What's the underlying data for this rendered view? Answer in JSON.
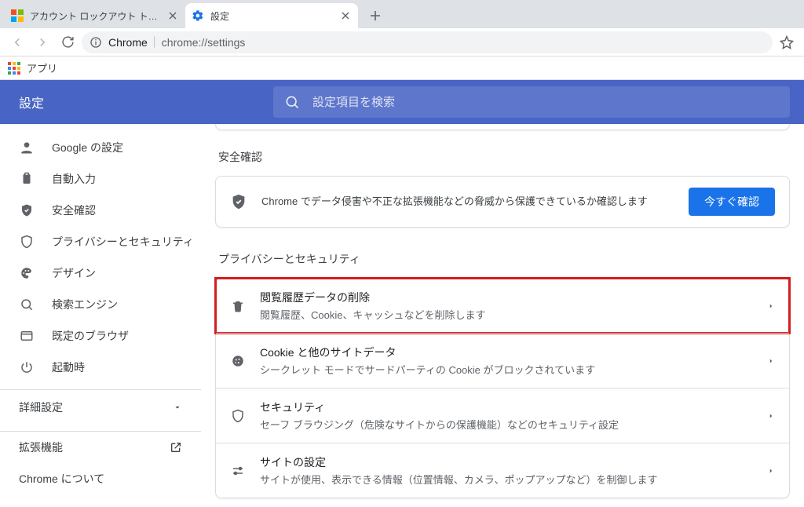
{
  "browser": {
    "tabs": [
      {
        "title": "アカウント ロックアウト トラブルシューティング",
        "active": false
      },
      {
        "title": "設定",
        "active": true
      }
    ],
    "omnibox": {
      "origin": "Chrome",
      "path": "chrome://settings"
    },
    "bookmarks_bar": {
      "apps_label": "アプリ"
    }
  },
  "settings": {
    "app_title": "設定",
    "search_placeholder": "設定項目を検索",
    "sidebar": {
      "items": [
        {
          "label": "Google の設定"
        },
        {
          "label": "自動入力"
        },
        {
          "label": "安全確認"
        },
        {
          "label": "プライバシーとセキュリティ"
        },
        {
          "label": "デザイン"
        },
        {
          "label": "検索エンジン"
        },
        {
          "label": "既定のブラウザ"
        },
        {
          "label": "起動時"
        }
      ],
      "advanced_label": "詳細設定",
      "footer": {
        "extensions_label": "拡張機能",
        "about_label": "Chrome について"
      }
    },
    "sections": {
      "safety": {
        "title": "安全確認",
        "card_text": "Chrome でデータ侵害や不正な拡張機能などの脅威から保護できているか確認します",
        "button_label": "今すぐ確認"
      },
      "privacy": {
        "title": "プライバシーとセキュリティ",
        "rows": [
          {
            "title": "閲覧履歴データの削除",
            "desc": "閲覧履歴、Cookie、キャッシュなどを削除します",
            "highlight": true
          },
          {
            "title": "Cookie と他のサイトデータ",
            "desc": "シークレット モードでサードパーティの Cookie がブロックされています",
            "highlight": false
          },
          {
            "title": "セキュリティ",
            "desc": "セーフ ブラウジング（危険なサイトからの保護機能）などのセキュリティ設定",
            "highlight": false
          },
          {
            "title": "サイトの設定",
            "desc": "サイトが使用、表示できる情報（位置情報、カメラ、ポップアップなど）を制御します",
            "highlight": false
          }
        ]
      }
    }
  }
}
